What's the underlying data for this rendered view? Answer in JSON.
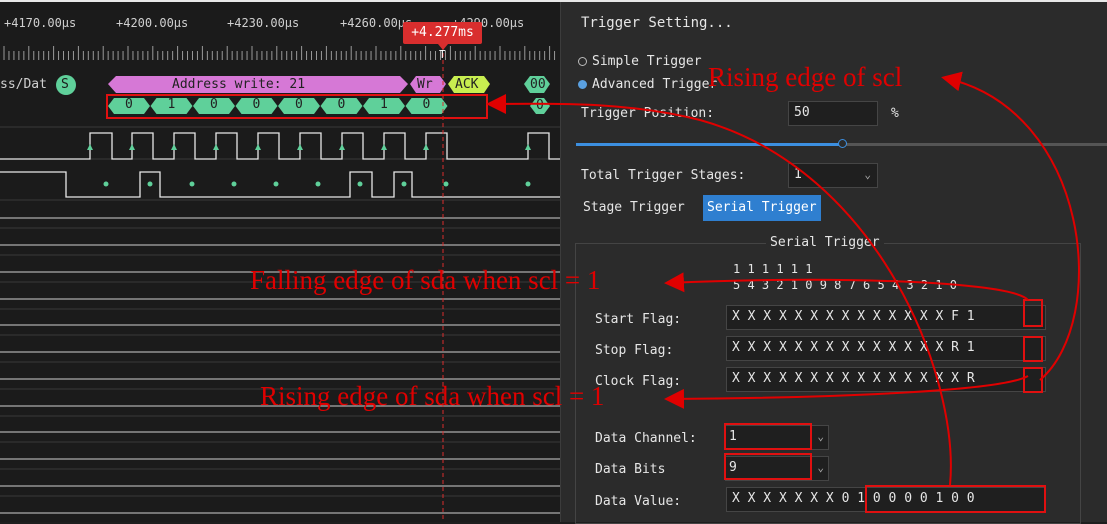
{
  "waveform": {
    "time_ticks": [
      "+4170.00µs",
      "+4200.00µs",
      "+4230.00µs",
      "+4260.00µs",
      "+4290.00µs"
    ],
    "cursor_label": "+4.277ms",
    "cursor_marker": "T",
    "channel_label": "ss/Dat",
    "start_marker": "S",
    "address_segment": "Address write: 21",
    "rw_segment": "Wr",
    "ack_segment": "ACK",
    "data_segment": "00",
    "bit_values": [
      "0",
      "1",
      "0",
      "0",
      "0",
      "0",
      "1",
      "0"
    ],
    "trailing_bit": "0",
    "colors": {
      "address": "#d678d6",
      "bits": "#5fd09a",
      "ack": "#c8ee50",
      "cursor": "#d92e2e"
    }
  },
  "panel": {
    "title": "Trigger Setting...",
    "simple_trigger": "Simple Trigger",
    "advanced_trigger": "Advanced Trigger",
    "selected_mode": "Advanced Trigger",
    "trigger_position_label": "Trigger Position:",
    "trigger_position_value": "50",
    "trigger_position_unit": "%",
    "trigger_position_fraction": 0.5,
    "total_stages_label": "Total Trigger Stages:",
    "total_stages_value": "1",
    "tab_stage": "Stage Trigger",
    "tab_serial": "Serial Trigger",
    "group_title": "Serial Trigger",
    "bit_header_top": "1 1 1 1 1 1",
    "bit_header_bottom": "5 4 3 2 1 0 9 8 7 6 5 4 3 2 1 0",
    "start_flag_label": "Start Flag:",
    "start_flag_mask": "X X X X X X X X X X X X X X",
    "start_flag_tail": "F 1",
    "stop_flag_label": "Stop Flag:",
    "stop_flag_mask": "X X X X X X X X X X X X X X",
    "stop_flag_tail": "R 1",
    "clock_flag_label": "Clock Flag:",
    "clock_flag_mask": "X X X X X X X X X X X X X X X",
    "clock_flag_tail": "R",
    "data_channel_label": "Data Channel:",
    "data_channel_value": "1",
    "data_bits_label": "Data Bits",
    "data_bits_value": "9",
    "data_value_label": "Data Value:",
    "data_value_mask": "X X X X X X X",
    "data_value_bits": "0 1 0 0 0 0 1 0 0"
  },
  "annotations": {
    "scl_rising": "Rising edge of scl",
    "sda_falling": "Falling edge of sda when scl = 1",
    "sda_rising": "Rising edge of sda when scl = 1"
  },
  "annotation_color": "#e00000"
}
